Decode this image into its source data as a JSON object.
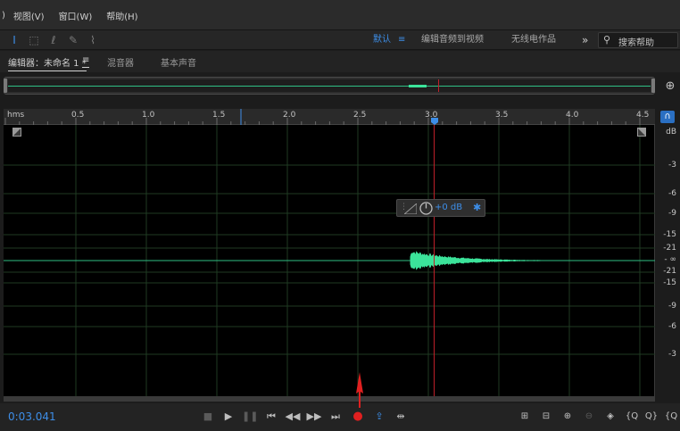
{
  "menu": {
    "items": [
      {
        "label": ")"
      },
      {
        "label": "视图(V)"
      },
      {
        "label": "窗口(W)"
      },
      {
        "label": "帮助(H)"
      }
    ]
  },
  "toolbar": {
    "tools": [
      {
        "name": "time-selection-tool-icon",
        "glyph": "I"
      },
      {
        "name": "marquee-selection-tool-icon",
        "glyph": "⬚"
      },
      {
        "name": "lasso-selection-tool-icon",
        "glyph": "ℓ"
      },
      {
        "name": "paintbrush-selection-tool-icon",
        "glyph": "✎"
      },
      {
        "name": "spot-healing-brush-tool-icon",
        "glyph": "⌇"
      }
    ],
    "workspaces": [
      {
        "label": "默认",
        "active": true
      },
      {
        "label": "编辑音频到视频",
        "active": false
      },
      {
        "label": "无线电作品",
        "active": false
      }
    ],
    "more_glyph": "»",
    "search_placeholder": "搜索帮助"
  },
  "panel_tabs": [
    {
      "label": "编辑器：未命名 1 *",
      "active": true
    },
    {
      "label": "混音器",
      "active": false
    },
    {
      "label": "基本声音",
      "active": false
    }
  ],
  "ruler": {
    "unit": "hms",
    "ticks": [
      "0.5",
      "1.0",
      "1.5",
      "2.0",
      "2.5",
      "3.0",
      "3.5",
      "4.0",
      "4.5"
    ]
  },
  "db_scale": {
    "unit": "dB",
    "upper": [
      "-3",
      "-6",
      "-9",
      "-15",
      "-21"
    ],
    "center": "- ∞",
    "lower": [
      "-21",
      "-15",
      "-9",
      "-6",
      "-3"
    ]
  },
  "hud": {
    "gain": "+0 dB"
  },
  "transport": {
    "timecode": "0:03.041"
  },
  "colors": {
    "accent": "#3d8ee8",
    "waveform": "#3be39a",
    "playhead": "#c0202a",
    "record": "#e02020"
  },
  "waveform_data": {
    "duration_seconds": 4.6,
    "playhead_seconds": 3.041,
    "onset_seconds": 2.87,
    "decay_end_seconds": 3.8
  }
}
